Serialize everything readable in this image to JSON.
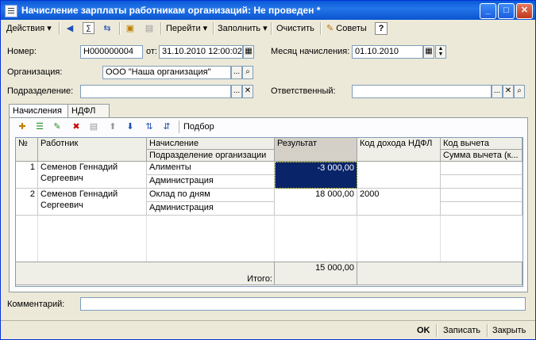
{
  "window": {
    "title": "Начисление зарплаты работникам организаций: Не проведен *",
    "controls": {
      "minimize": "_",
      "maximize": "□",
      "close": "✕"
    }
  },
  "toolbar": {
    "actions_label": "Действия",
    "goto_label": "Перейти",
    "fill_label": "Заполнить",
    "clear_label": "Очистить",
    "tips_label": "Советы",
    "help_label": "?"
  },
  "form": {
    "number_label": "Номер:",
    "number_value": "Н000000004",
    "date_label": "от:",
    "date_value": "31.10.2010 12:00:02",
    "month_label": "Месяц начисления:",
    "month_value": "01.10.2010",
    "org_label": "Организация:",
    "org_value": "ООО \"Наша организация\"",
    "dept_label": "Подразделение:",
    "dept_value": "",
    "responsible_label": "Ответственный:",
    "responsible_value": "",
    "comment_label": "Комментарий:",
    "comment_value": ""
  },
  "tabs": [
    {
      "label": "Начисления",
      "active": true
    },
    {
      "label": "НДФЛ",
      "active": false
    }
  ],
  "grid_toolbar": {
    "selection_label": "Подбор"
  },
  "grid": {
    "headers": {
      "num": "№",
      "employee": "Работник",
      "accrual": "Начисление",
      "department": "Подразделение организации",
      "result": "Результат",
      "income_code": "Код дохода НДФЛ",
      "deduction_code": "Код вычета",
      "deduction_sum": "Сумма вычета (к..."
    },
    "rows": [
      {
        "num": "1",
        "employee": "Семенов Геннадий Сергеевич",
        "accrual": "Алименты",
        "department": "Администрация",
        "result": "-3 000,00",
        "income_code": "",
        "deduction_code": "",
        "deduction_sum": ""
      },
      {
        "num": "2",
        "employee": "Семенов Геннадий Сергеевич",
        "accrual": "Оклад по дням",
        "department": "Администрация",
        "result": "18 000,00",
        "income_code": "2000",
        "deduction_code": "",
        "deduction_sum": ""
      }
    ],
    "total_value": "15 000,00",
    "total_label": "Итого:"
  },
  "footer": {
    "ok_label": "OK",
    "save_label": "Записать",
    "close_label": "Закрыть"
  }
}
